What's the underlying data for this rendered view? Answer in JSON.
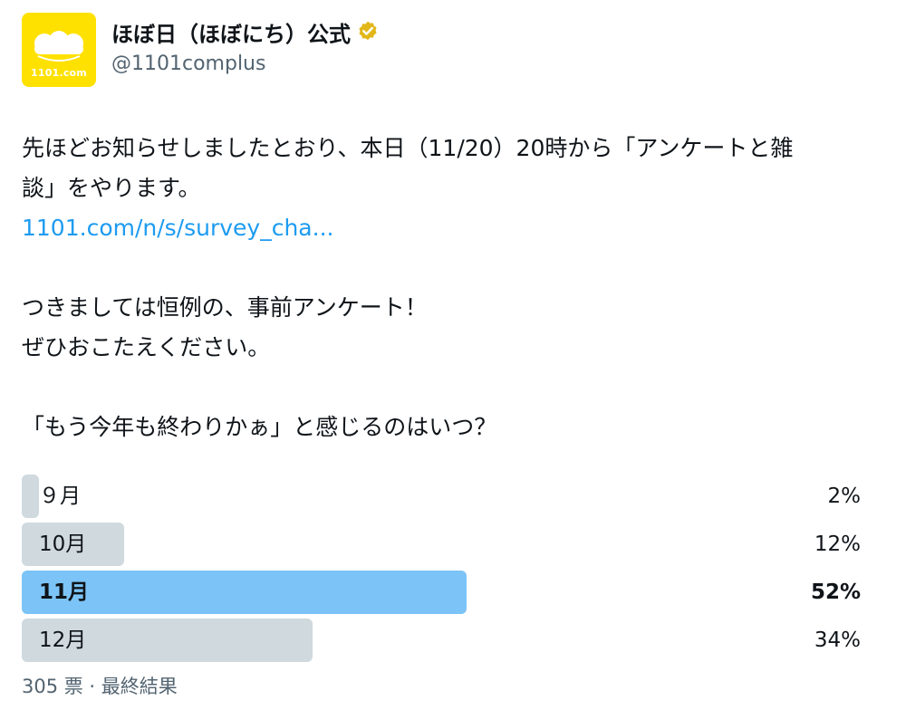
{
  "user": {
    "display_name": "ほぼ日（ほぼにち）公式",
    "handle": "@1101complus",
    "avatar_text": "1101.com",
    "verified": true,
    "avatar_color": "#ffe100",
    "verified_color": "#e2b719"
  },
  "tweet": {
    "line1": "先ほどお知らせしましたとおり、本日（11/20）20時から「アンケートと雑",
    "line2": "談」をやります。",
    "link": "1101.com/n/s/survey_cha...",
    "line3": "つきましては恒例の、事前アンケート！",
    "line4": "ぜひおこたえください。",
    "line5": "「もう今年も終わりかぁ」と感じるのはいつ？"
  },
  "poll": {
    "options": [
      {
        "label": "９月",
        "percent_text": "2%",
        "percent": 2,
        "winner": false
      },
      {
        "label": "10月",
        "percent_text": "12%",
        "percent": 12,
        "winner": false
      },
      {
        "label": "11月",
        "percent_text": "52%",
        "percent": 52,
        "winner": true
      },
      {
        "label": "12月",
        "percent_text": "34%",
        "percent": 34,
        "winner": false
      }
    ],
    "footer": "305 票 · 最終結果",
    "bar_color": "#cfd9de",
    "winner_color": "#7cc4f7"
  },
  "colors": {
    "link": "#1d9bf0",
    "secondary_text": "#536471"
  }
}
